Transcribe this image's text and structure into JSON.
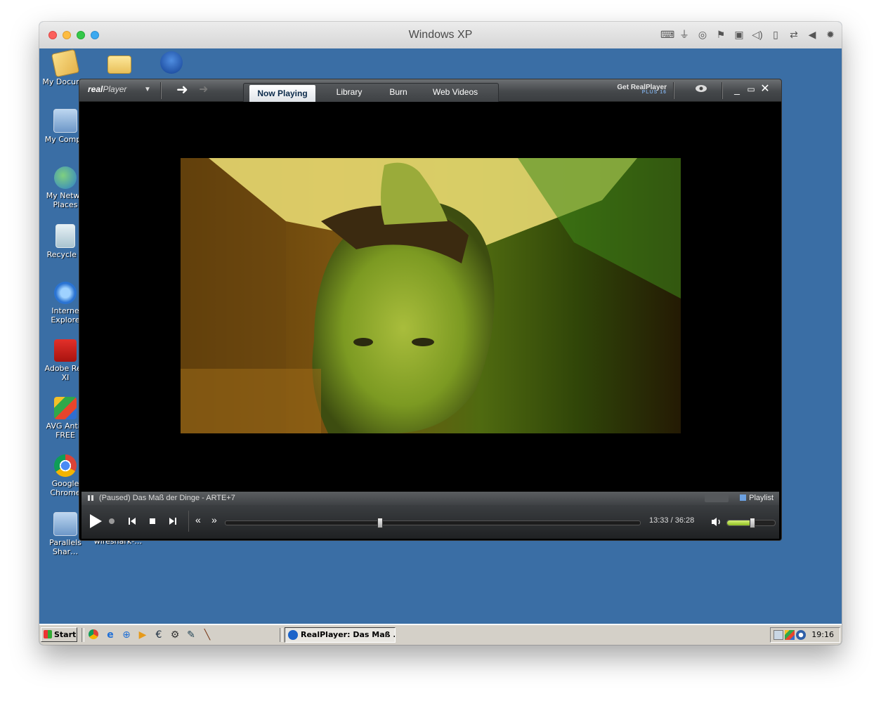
{
  "mac_window": {
    "title": "Windows XP",
    "toolbar_icons": [
      "keyboard-icon",
      "usb-icon",
      "cd-icon",
      "network-icon",
      "save-icon",
      "sound-icon",
      "tablet-icon",
      "folder-share-icon",
      "back-triangle-icon",
      "gear-icon"
    ]
  },
  "desktop": {
    "icons": [
      {
        "label": "My Docume",
        "icon": "my-documents-icon"
      },
      {
        "label": "My Compu",
        "icon": "my-computer-icon"
      },
      {
        "label": "My Netwo\nPlaces",
        "icon": "network-places-icon"
      },
      {
        "label": "Recycle E",
        "icon": "recycle-bin-icon"
      },
      {
        "label": "Interne\nExplore",
        "icon": "internet-explorer-icon"
      },
      {
        "label": "Adobe Rea\nXI",
        "icon": "adobe-reader-icon"
      },
      {
        "label": "AVG Antiv\nFREE",
        "icon": "avg-antivirus-icon"
      },
      {
        "label": "Google\nChrome",
        "icon": "chrome-icon"
      },
      {
        "label": "Parallels\nShar…",
        "icon": "parallels-shared-icon"
      }
    ],
    "wireshark_label": "wireshark-…"
  },
  "player": {
    "logo": "real",
    "logo_sub": "Player",
    "tabs": [
      "Now Playing",
      "Library",
      "Burn",
      "Web Videos"
    ],
    "active_tab": "Now Playing",
    "get_real": "Get RealPlayer",
    "get_real_sub": "PLUS 16",
    "status_text": "(Paused) Das Maß der Dinge - ARTE+7",
    "playlist_label": "Playlist",
    "time": "13:33 / 36:28",
    "progress_fraction": 0.372,
    "volume_fraction": 0.52
  },
  "taskbar": {
    "start_label": "Start",
    "quick_launch": [
      "chrome-icon",
      "ie-icon",
      "ie-alt-icon",
      "media-player-icon",
      "euro-icon",
      "settings-icon",
      "wrench-icon",
      "pen-icon"
    ],
    "task_label": "RealPlayer: Das Maß ...",
    "clock": "19:16"
  }
}
